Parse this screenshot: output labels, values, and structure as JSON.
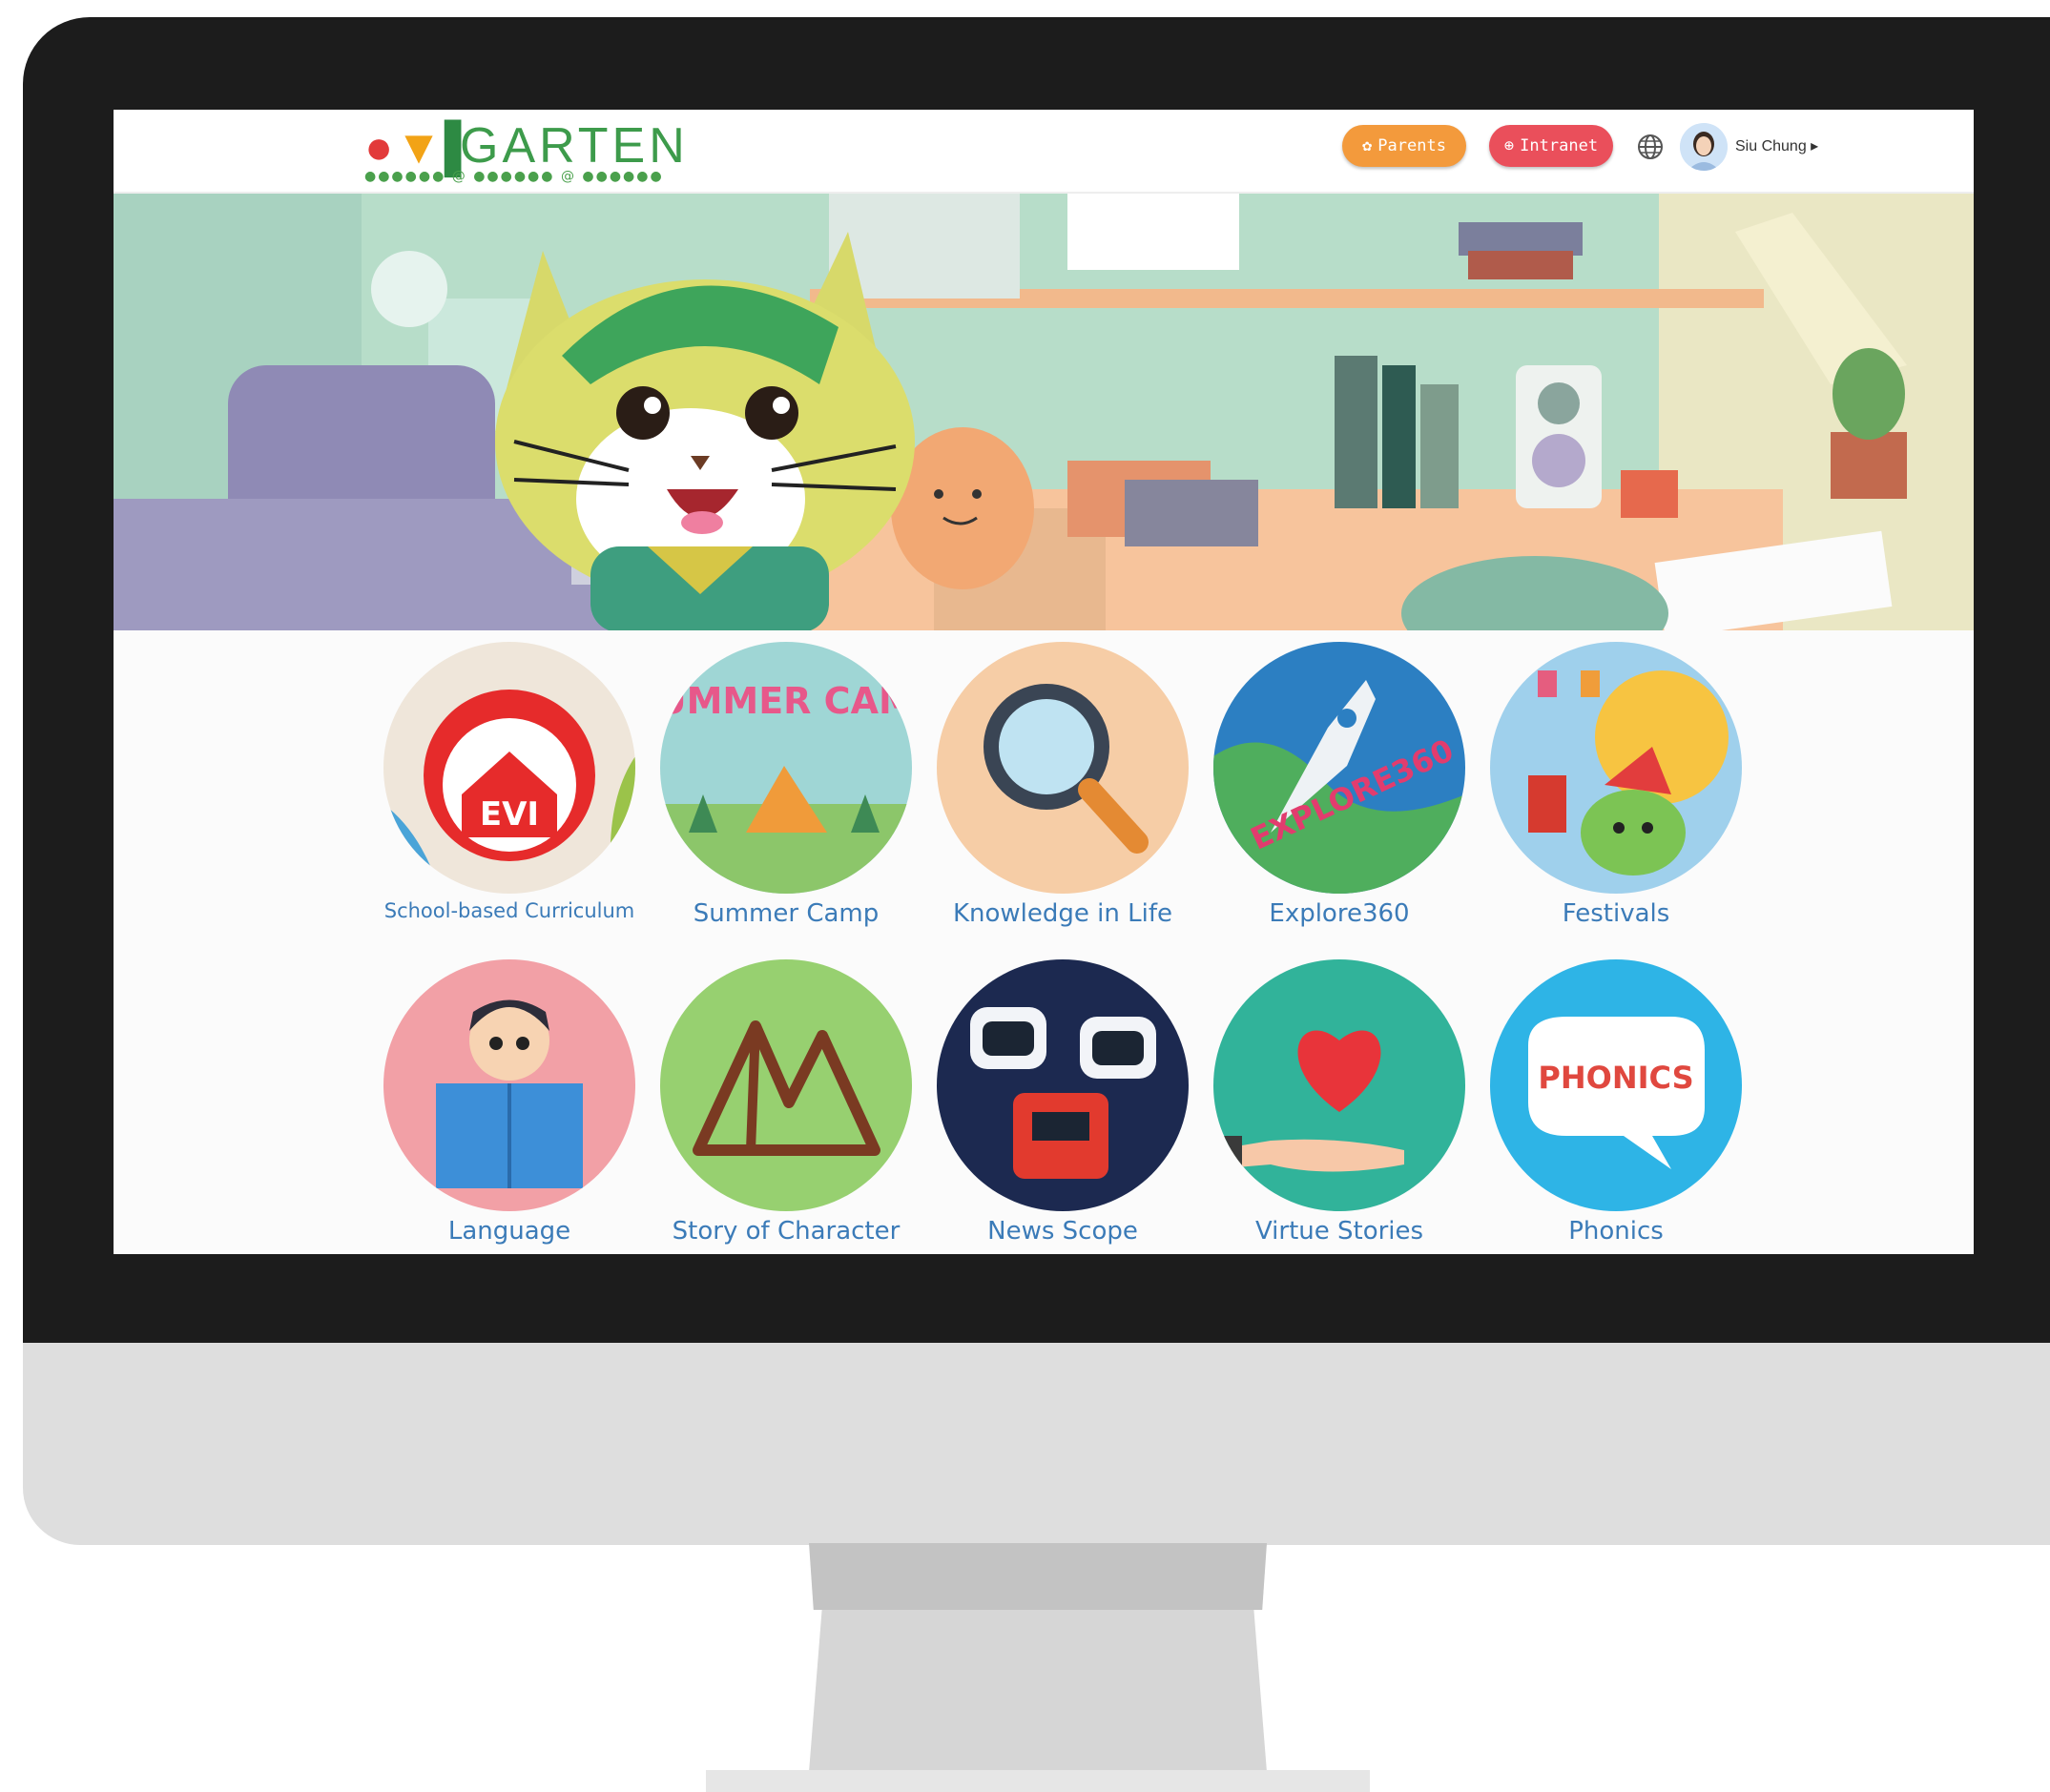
{
  "header": {
    "logo_text": "GARTEN",
    "logo_mark": "EVI",
    "parents_label": "Parents",
    "intranet_label": "Intranet",
    "globe_icon": "globe-icon",
    "user_name": "Siu Chung",
    "user_caret": "▸"
  },
  "tiles": [
    {
      "label": "School-based Curriculum",
      "icon": "evi-house-icon"
    },
    {
      "label": "Summer Camp",
      "icon": "summer-camp-icon",
      "art_text": "SUMMER CAMP"
    },
    {
      "label": "Knowledge in Life",
      "icon": "magnifier-icon"
    },
    {
      "label": "Explore360",
      "icon": "rocket-globe-icon",
      "art_text": "EXPLORE360"
    },
    {
      "label": "Festivals",
      "icon": "lantern-festival-icon"
    },
    {
      "label": "Language",
      "icon": "boy-reading-icon"
    },
    {
      "label": "Story of Character",
      "icon": "mountains-icon"
    },
    {
      "label": "News Scope",
      "icon": "robots-icon"
    },
    {
      "label": "Virtue Stories",
      "icon": "heart-hand-icon"
    },
    {
      "label": "Phonics",
      "icon": "speech-bubble-icon",
      "art_text": "PHONICS"
    }
  ],
  "colors": {
    "parents": "#f39a3c",
    "intranet": "#ea4f5b",
    "label": "#3b7bb8"
  }
}
